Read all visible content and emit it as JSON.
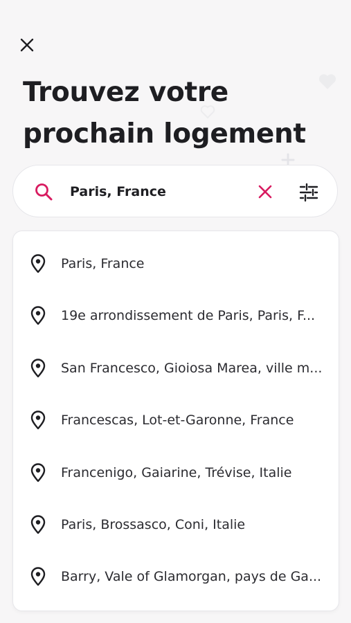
{
  "header": {
    "title_line1": "Trouvez votre",
    "title_line2": "prochain logement"
  },
  "search": {
    "value": "Paris, France",
    "icon": "search-icon",
    "clear_icon": "close-icon",
    "filter_icon": "sliders-icon"
  },
  "suggestions": [
    {
      "label": "Paris, France"
    },
    {
      "label": "19e arrondissement de Paris, Paris, F..."
    },
    {
      "label": "San Francesco, Gioiosa Marea, ville m..."
    },
    {
      "label": "Francescas, Lot-et-Garonne, France"
    },
    {
      "label": "Francenigo, Gaiarine, Trévise, Italie"
    },
    {
      "label": "Paris, Brossasco, Coni, Italie"
    },
    {
      "label": "Barry, Vale of Glamorgan, pays de Ga..."
    }
  ],
  "colors": {
    "accent": "#d81b60",
    "text": "#1e1e22",
    "background": "#f7f6f7"
  }
}
